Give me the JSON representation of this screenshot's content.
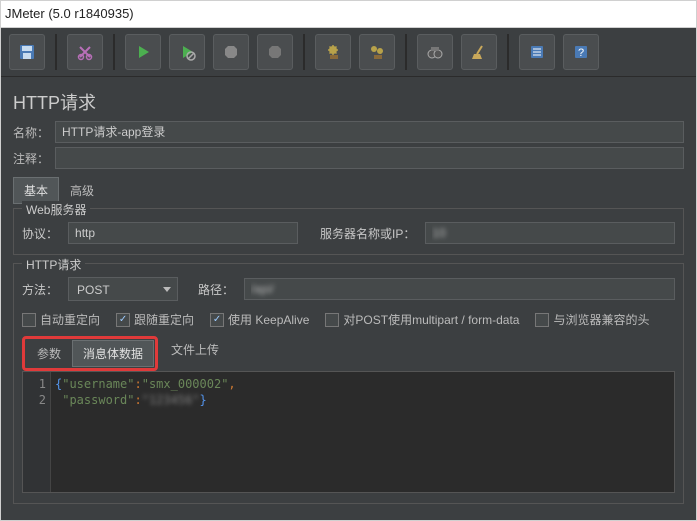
{
  "window": {
    "title": "JMeter (5.0 r1840935)"
  },
  "page": {
    "title": "HTTP请求",
    "name_label": "名称：",
    "name_value": "HTTP请求-app登录",
    "comment_label": "注释：",
    "comment_value": ""
  },
  "config_tabs": {
    "basic": "基本",
    "advanced": "高级",
    "active": "basic"
  },
  "web_server": {
    "legend": "Web服务器",
    "protocol_label": "协议：",
    "protocol_value": "http",
    "server_label": "服务器名称或IP：",
    "server_value": "10"
  },
  "http_request": {
    "legend": "HTTP请求",
    "method_label": "方法：",
    "method_value": "POST",
    "path_label": "路径：",
    "path_value": "/api/"
  },
  "options": {
    "redirect_auto": {
      "label": "自动重定向",
      "checked": false
    },
    "follow_redirect": {
      "label": "跟随重定向",
      "checked": true
    },
    "keepalive": {
      "label": "使用 KeepAlive",
      "checked": true
    },
    "multipart": {
      "label": "对POST使用multipart / form-data",
      "checked": false
    },
    "browser_headers": {
      "label": "与浏览器兼容的头",
      "checked": false
    }
  },
  "body_tabs": {
    "params": "参数",
    "body": "消息体数据",
    "file": "文件上传",
    "active": "body"
  },
  "editor": {
    "line1": "1",
    "line2": "2",
    "code_line1_key": "\"username\"",
    "code_line1_sep": ":",
    "code_line1_val": "\"smx_000002\"",
    "code_line1_end": ",",
    "code_line2_key": "\"password\"",
    "code_line2_sep": ":",
    "code_line2_val": "\"123456\""
  }
}
